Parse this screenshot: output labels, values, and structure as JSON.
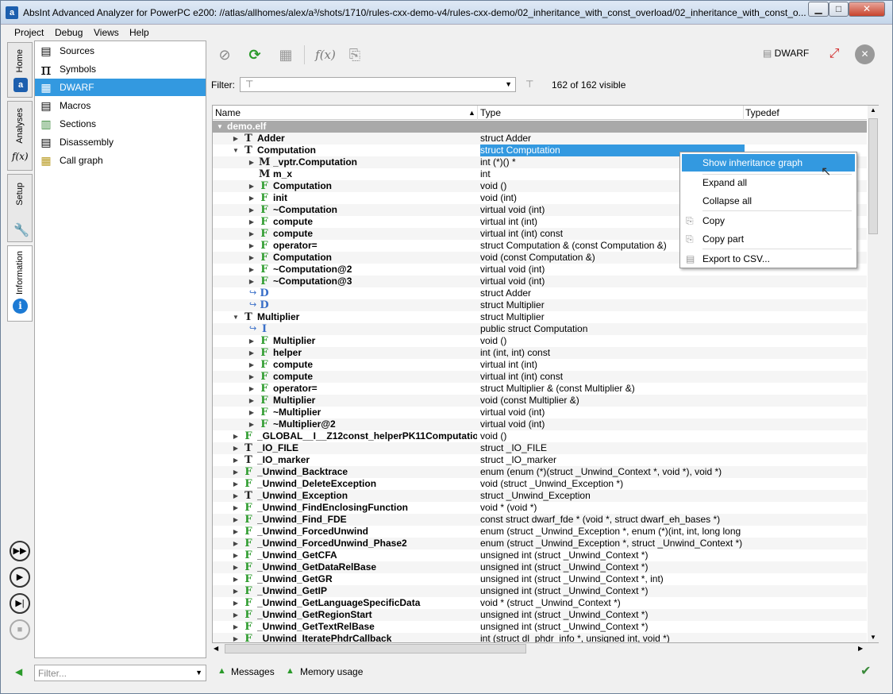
{
  "window": {
    "title": "AbsInt Advanced Analyzer for PowerPC e200: //atlas/allhomes/alex/a³/shots/1710/rules-cxx-demo-v4/rules-cxx-demo/02_inheritance_with_const_overload/02_inheritance_with_const_o...",
    "app_icon": "a³"
  },
  "menu": [
    "Project",
    "Debug",
    "Views",
    "Help"
  ],
  "left_tabs": [
    "Home",
    "Analyses",
    "Setup",
    "Information"
  ],
  "nav": [
    {
      "label": "Sources",
      "icon": "sources-icon"
    },
    {
      "label": "Symbols",
      "icon": "pi-icon"
    },
    {
      "label": "DWARF",
      "icon": "dwarf-icon"
    },
    {
      "label": "Macros",
      "icon": "macros-icon"
    },
    {
      "label": "Sections",
      "icon": "sections-icon"
    },
    {
      "label": "Disassembly",
      "icon": "disassembly-icon"
    },
    {
      "label": "Call graph",
      "icon": "callgraph-icon"
    }
  ],
  "nav_filter_placeholder": "Filter...",
  "toolbar": {
    "fx": "f(x)",
    "dwarf": "DWARF"
  },
  "filter": {
    "label": "Filter:",
    "value": "",
    "visible": "162 of 162 visible"
  },
  "columns": [
    "Name",
    "Type",
    "Typedef"
  ],
  "rows": [
    {
      "a": "d",
      "k": "",
      "n": "demo.elf",
      "t": "",
      "l": 0
    },
    {
      "a": "r",
      "k": "T",
      "n": "Adder",
      "t": "struct Adder",
      "l": 1
    },
    {
      "a": "d",
      "k": "T",
      "n": "Computation",
      "t": "struct Computation",
      "l": 1,
      "sel": true
    },
    {
      "a": "r",
      "k": "M",
      "n": "_vptr.Computation",
      "t": "int (*)() *",
      "l": 2
    },
    {
      "a": "",
      "k": "M",
      "n": "m_x",
      "t": "int",
      "l": 2
    },
    {
      "a": "r",
      "k": "F",
      "n": "Computation",
      "t": "void ()",
      "l": 2
    },
    {
      "a": "r",
      "k": "F",
      "n": "init",
      "t": "void (int)",
      "l": 2
    },
    {
      "a": "r",
      "k": "F",
      "n": "~Computation",
      "t": "virtual void (int)",
      "l": 2
    },
    {
      "a": "r",
      "k": "F",
      "n": "compute",
      "t": "virtual int (int)",
      "l": 2
    },
    {
      "a": "r",
      "k": "F",
      "n": "compute",
      "t": "virtual int (int) const",
      "l": 2
    },
    {
      "a": "r",
      "k": "F",
      "n": "operator=",
      "t": "struct Computation & (const Computation &)",
      "l": 2
    },
    {
      "a": "r",
      "k": "F",
      "n": "Computation",
      "t": "void (const Computation &)",
      "l": 2
    },
    {
      "a": "r",
      "k": "F",
      "n": "~Computation@2",
      "t": "virtual void (int)",
      "l": 2
    },
    {
      "a": "r",
      "k": "F",
      "n": "~Computation@3",
      "t": "virtual void (int)",
      "l": 2
    },
    {
      "a": "",
      "k": "D",
      "n": "",
      "t": "struct Adder",
      "l": 2,
      "ref": true
    },
    {
      "a": "",
      "k": "D",
      "n": "",
      "t": "struct Multiplier",
      "l": 2,
      "ref": true
    },
    {
      "a": "d",
      "k": "T",
      "n": "Multiplier",
      "t": "struct Multiplier",
      "l": 1
    },
    {
      "a": "",
      "k": "I",
      "n": "",
      "t": "public struct Computation",
      "l": 2,
      "ref": true
    },
    {
      "a": "r",
      "k": "F",
      "n": "Multiplier",
      "t": "void ()",
      "l": 2
    },
    {
      "a": "r",
      "k": "F",
      "n": "helper",
      "t": "int (int, int) const",
      "l": 2
    },
    {
      "a": "r",
      "k": "F",
      "n": "compute",
      "t": "virtual int (int)",
      "l": 2
    },
    {
      "a": "r",
      "k": "F",
      "n": "compute",
      "t": "virtual int (int) const",
      "l": 2
    },
    {
      "a": "r",
      "k": "F",
      "n": "operator=",
      "t": "struct Multiplier & (const Multiplier &)",
      "l": 2
    },
    {
      "a": "r",
      "k": "F",
      "n": "Multiplier",
      "t": "void (const Multiplier &)",
      "l": 2
    },
    {
      "a": "r",
      "k": "F",
      "n": "~Multiplier",
      "t": "virtual void (int)",
      "l": 2
    },
    {
      "a": "r",
      "k": "F",
      "n": "~Multiplier@2",
      "t": "virtual void (int)",
      "l": 2
    },
    {
      "a": "r",
      "k": "F",
      "n": "_GLOBAL__I__Z12const_helperPK11Computatio",
      "t": "void ()",
      "l": 1
    },
    {
      "a": "r",
      "k": "T",
      "n": "_IO_FILE",
      "t": "struct _IO_FILE",
      "l": 1
    },
    {
      "a": "r",
      "k": "T",
      "n": "_IO_marker",
      "t": "struct _IO_marker",
      "l": 1
    },
    {
      "a": "r",
      "k": "F",
      "n": "_Unwind_Backtrace",
      "t": "enum (enum (*)(struct _Unwind_Context *, void *), void *)",
      "l": 1
    },
    {
      "a": "r",
      "k": "F",
      "n": "_Unwind_DeleteException",
      "t": "void (struct _Unwind_Exception *)",
      "l": 1
    },
    {
      "a": "r",
      "k": "T",
      "n": "_Unwind_Exception",
      "t": "struct _Unwind_Exception",
      "l": 1
    },
    {
      "a": "r",
      "k": "F",
      "n": "_Unwind_FindEnclosingFunction",
      "t": "void * (void *)",
      "l": 1
    },
    {
      "a": "r",
      "k": "F",
      "n": "_Unwind_Find_FDE",
      "t": "const struct dwarf_fde * (void *, struct dwarf_eh_bases *)",
      "l": 1
    },
    {
      "a": "r",
      "k": "F",
      "n": "_Unwind_ForcedUnwind",
      "t": "enum (struct _Unwind_Exception *, enum (*)(int, int, long long",
      "l": 1
    },
    {
      "a": "r",
      "k": "F",
      "n": "_Unwind_ForcedUnwind_Phase2",
      "t": "enum (struct _Unwind_Exception *, struct _Unwind_Context *)",
      "l": 1
    },
    {
      "a": "r",
      "k": "F",
      "n": "_Unwind_GetCFA",
      "t": "unsigned int (struct _Unwind_Context *)",
      "l": 1
    },
    {
      "a": "r",
      "k": "F",
      "n": "_Unwind_GetDataRelBase",
      "t": "unsigned int (struct _Unwind_Context *)",
      "l": 1
    },
    {
      "a": "r",
      "k": "F",
      "n": "_Unwind_GetGR",
      "t": "unsigned int (struct _Unwind_Context *, int)",
      "l": 1
    },
    {
      "a": "r",
      "k": "F",
      "n": "_Unwind_GetIP",
      "t": "unsigned int (struct _Unwind_Context *)",
      "l": 1
    },
    {
      "a": "r",
      "k": "F",
      "n": "_Unwind_GetLanguageSpecificData",
      "t": "void * (struct _Unwind_Context *)",
      "l": 1
    },
    {
      "a": "r",
      "k": "F",
      "n": "_Unwind_GetRegionStart",
      "t": "unsigned int (struct _Unwind_Context *)",
      "l": 1
    },
    {
      "a": "r",
      "k": "F",
      "n": "_Unwind_GetTextRelBase",
      "t": "unsigned int (struct _Unwind_Context *)",
      "l": 1
    },
    {
      "a": "r",
      "k": "F",
      "n": "_Unwind_IteratePhdrCallback",
      "t": "int (struct dl_phdr_info *, unsigned int, void *)",
      "l": 1
    }
  ],
  "context_menu": [
    "Show inheritance graph",
    "Expand all",
    "Collapse all",
    "Copy",
    "Copy part",
    "Export to CSV..."
  ],
  "status": {
    "messages": "Messages",
    "memory": "Memory usage"
  }
}
